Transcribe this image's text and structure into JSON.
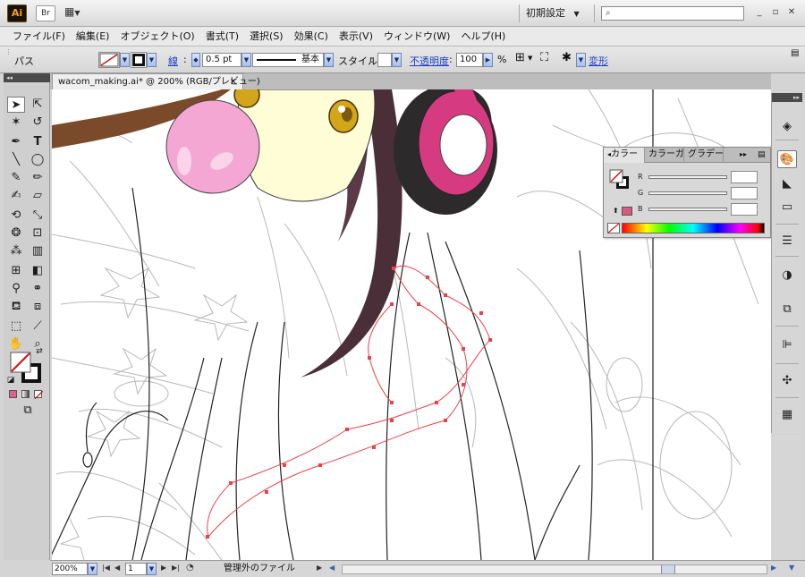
{
  "app": {
    "logo_text": "Ai",
    "bridge_text": "Br",
    "workspace": "初期設定",
    "window_controls": [
      "_",
      "▫",
      "✕"
    ]
  },
  "menu": [
    "ファイル(F)",
    "編集(E)",
    "オブジェクト(O)",
    "書式(T)",
    "選択(S)",
    "効果(C)",
    "表示(V)",
    "ウィンドウ(W)",
    "ヘルプ(H)"
  ],
  "control_bar": {
    "selection_label": "パス",
    "stroke_label": "線",
    "stroke_weight": "0.5 pt",
    "brush_label": "基本",
    "style_label": "スタイル",
    "opacity_label": "不透明度",
    "opacity_value": "100",
    "opacity_unit": "%",
    "transform_label": "変形"
  },
  "document": {
    "tab_title": "wacom_making.ai* @ 200% (RGB/プレビュー)",
    "close_glyph": "×"
  },
  "color_panel": {
    "tabs": [
      "カラー",
      "カラーガイド",
      "グラデーション"
    ],
    "sliders": [
      {
        "letter": "R",
        "value": ""
      },
      {
        "letter": "G",
        "value": ""
      },
      {
        "letter": "B",
        "value": ""
      }
    ]
  },
  "status_bar": {
    "zoom": "200%",
    "artboard": "1",
    "status_text": "管理外のファイル"
  },
  "colors": {
    "headphone_pink": "#d63a80",
    "headphone_dark": "#2d2a2b",
    "bubble_pink": "#f4a7d3",
    "hair": "#4a2f38",
    "skin": "#fffdd6",
    "eye": "#d3a51a",
    "selected_path": "#e8424a"
  }
}
